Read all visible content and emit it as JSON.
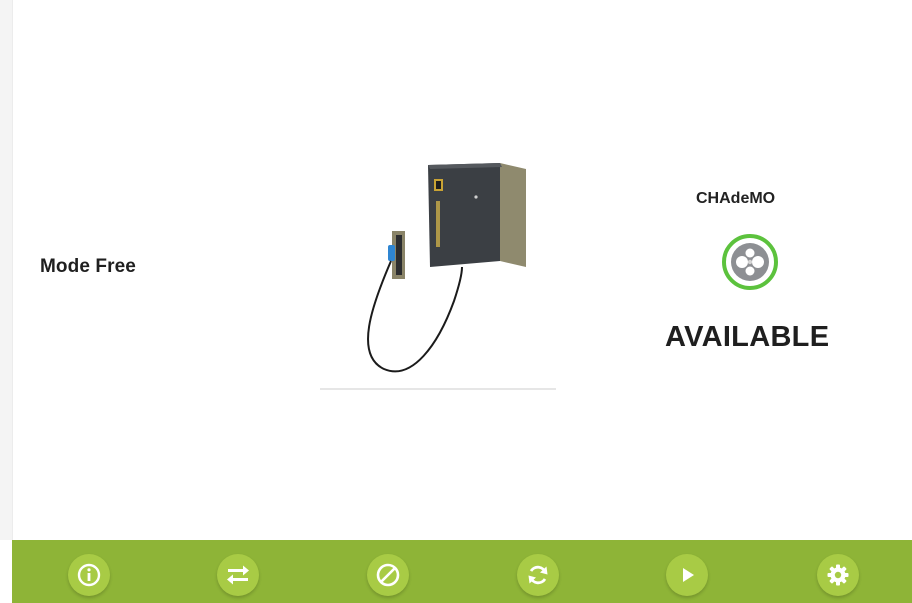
{
  "main": {
    "mode_label": "Mode Free",
    "connector": {
      "name": "CHAdeMO",
      "status": "AVAILABLE",
      "icon": "chademo-plug-icon",
      "ring_color": "#5cc23d"
    }
  },
  "toolbar": {
    "background": "#8eb437",
    "button_color": "#a8cb45",
    "buttons": [
      {
        "icon": "info-icon"
      },
      {
        "icon": "transfer-arrows-icon"
      },
      {
        "icon": "block-icon"
      },
      {
        "icon": "refresh-icon"
      },
      {
        "icon": "play-icon"
      },
      {
        "icon": "gear-icon"
      }
    ]
  }
}
